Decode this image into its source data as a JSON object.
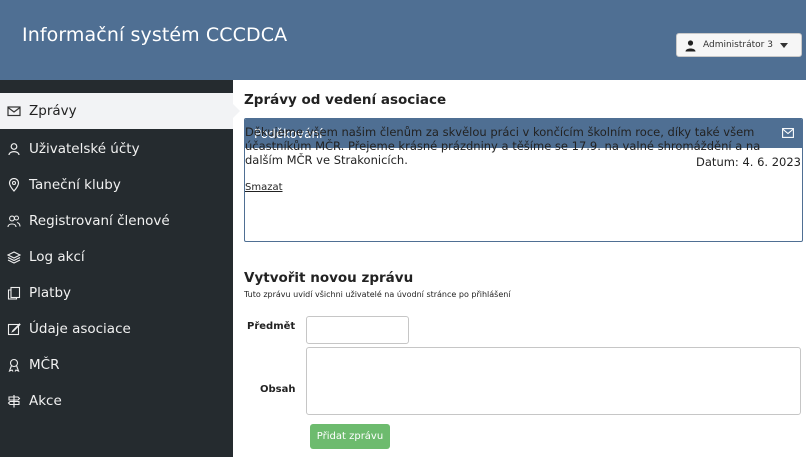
{
  "header": {
    "title": "Informační systém CCCDCA",
    "user_label": "Administrátor 3"
  },
  "sidebar": {
    "items": [
      {
        "label": "Zprávy",
        "icon": "envelope-icon",
        "active": true
      },
      {
        "label": "Uživatelské účty",
        "icon": "user-icon"
      },
      {
        "label": "Taneční kluby",
        "icon": "location-pin-icon"
      },
      {
        "label": "Registrovaní členové",
        "icon": "users-icon"
      },
      {
        "label": "Log akcí",
        "icon": "layers-icon"
      },
      {
        "label": "Platby",
        "icon": "documents-icon"
      },
      {
        "label": "Údaje asociace",
        "icon": "edit-icon"
      },
      {
        "label": "MČR",
        "icon": "trophy-icon"
      },
      {
        "label": "Akce",
        "icon": "signpost-icon"
      }
    ]
  },
  "main": {
    "heading": "Zprávy od vedení asociace",
    "message": {
      "title": "Poděkování",
      "text": "Děkujeme všem našim členům za skvělou práci v končícím školním roce, díky také všem účastníkům MČR. Přejeme krásné prázdniny a těšíme se 17.9. na valné shromáždění a na dalším MČR ve Strakonicích.",
      "date": "Datum: 4. 6. 2023",
      "delete_label": "Smazat"
    },
    "new_message": {
      "heading": "Vytvořit novou zprávu",
      "subtitle": "Tuto zprávu uvidí všichni uživatelé na úvodní stránce po přihlášení",
      "subject_label": "Předmět",
      "subject_value": "",
      "body_label": "Obsah",
      "body_value": "",
      "submit_label": "Přidat zprávu"
    }
  },
  "colors": {
    "header_bg": "#4f6f93",
    "sidebar_bg": "#252b2f",
    "submit_bg": "#6dbb6e"
  }
}
